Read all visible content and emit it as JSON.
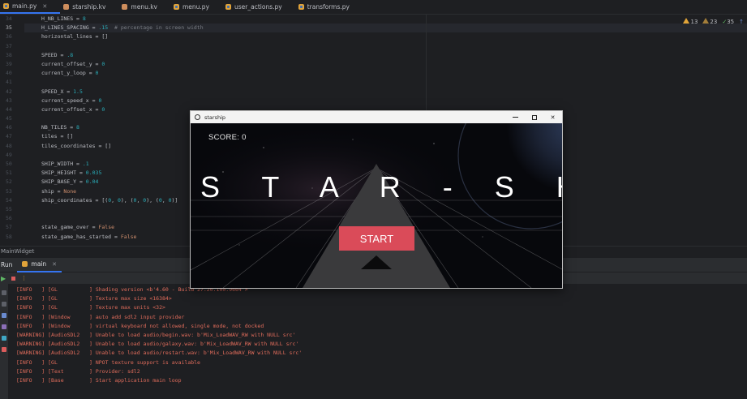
{
  "tabs": [
    {
      "label": "main.py",
      "icon": "python-file-icon",
      "active": true,
      "closable": true
    },
    {
      "label": "starship.kv",
      "icon": "kv-file-icon"
    },
    {
      "label": "menu.kv",
      "icon": "kv-file-icon"
    },
    {
      "label": "menu.py",
      "icon": "python-file-icon"
    },
    {
      "label": "user_actions.py",
      "icon": "python-file-icon"
    },
    {
      "label": "transforms.py",
      "icon": "python-file-icon"
    }
  ],
  "inspections": {
    "warnings": "13",
    "weak_warnings": "23",
    "ok": "35"
  },
  "editor": {
    "line_numbers": [
      "34",
      "35",
      "36",
      "37",
      "38",
      "39",
      "40",
      "41",
      "42",
      "43",
      "44",
      "45",
      "46",
      "47",
      "48",
      "49",
      "50",
      "51",
      "52",
      "53",
      "54",
      "55",
      "56",
      "57",
      "58"
    ],
    "current_line": "35"
  },
  "breadcrumb": "MainWidget",
  "run": {
    "label": "Run",
    "tab_label": "main",
    "console_lines": [
      "[INFO   ] [GL          ] Shading version <b'4.60 - Build 27.20.100.9664'>",
      "[INFO   ] [GL          ] Texture max size <16384>",
      "[INFO   ] [GL          ] Texture max units <32>",
      "[INFO   ] [Window      ] auto add sdl2 input provider",
      "[INFO   ] [Window      ] virtual keyboard not allowed, single mode, not docked",
      "[WARNING] [AudioSDL2   ] Unable to load audio/begin.wav: b'Mix_LoadWAV_RW with NULL src'",
      "[WARNING] [AudioSDL2   ] Unable to load audio/galaxy.wav: b'Mix_LoadWAV_RW with NULL src'",
      "[WARNING] [AudioSDL2   ] Unable to load audio/restart.wav: b'Mix_LoadWAV_RW with NULL src'",
      "[INFO   ] [GL          ] NPOT texture support is available",
      "[INFO   ] [Text        ] Provider: sdl2",
      "[INFO   ] [Base        ] Start application main loop"
    ]
  },
  "game": {
    "window_title": "starship",
    "score": "SCORE: 0",
    "title": "S T A R - S H I P",
    "start_label": "START"
  },
  "colors": {
    "accent": "#3574f0",
    "console_text": "#e06c5b",
    "start_button": "#da4b59",
    "number": "#2aacb8",
    "keyword": "#cf8e6d"
  }
}
